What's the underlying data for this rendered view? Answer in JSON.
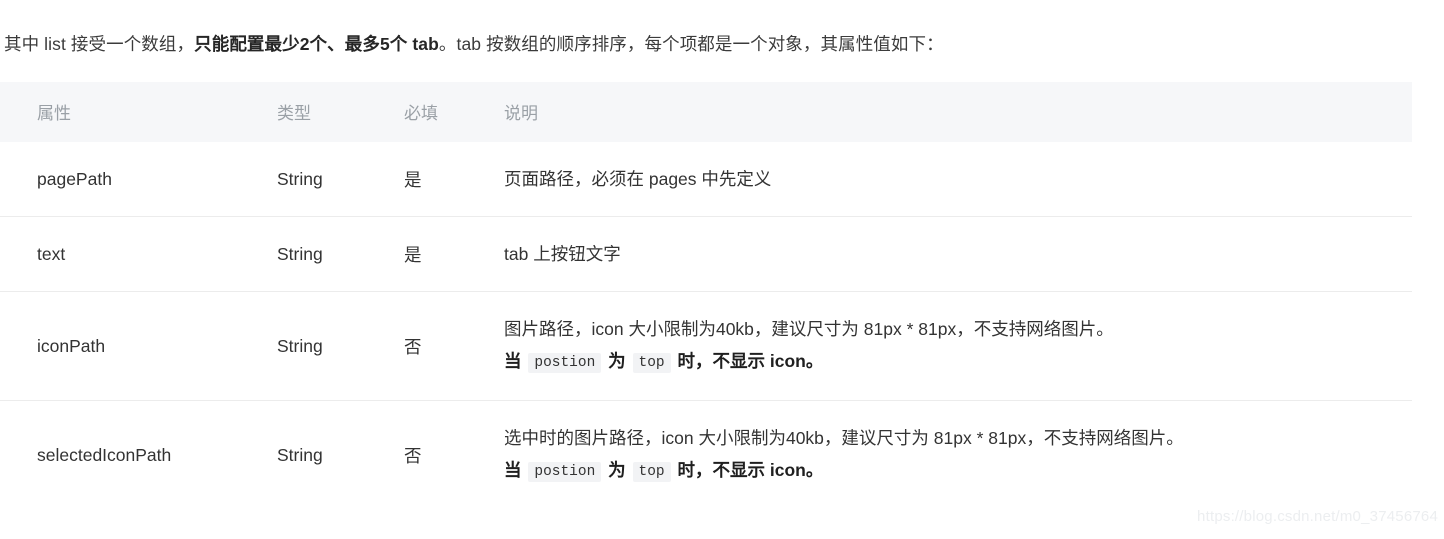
{
  "intro": {
    "segments": [
      {
        "text": "其中 list 接受一个数组，",
        "bold": false
      },
      {
        "text": "只能配置最少2个、最多5个 tab",
        "bold": true
      },
      {
        "text": "。tab 按数组的顺序排序，每个项都是一个对象，其属性值如下：",
        "bold": false
      }
    ],
    "plain": "其中 list 接受一个数组，只能配置最少2个、最多5个 tab。tab 按数组的顺序排序，每个项都是一个对象，其属性值如下："
  },
  "table": {
    "headers": {
      "attribute": "属性",
      "type": "类型",
      "required": "必填",
      "description": "说明"
    },
    "rows": [
      {
        "attribute": "pagePath",
        "type": "String",
        "required": "是",
        "lines": [
          {
            "bold": false,
            "parts": [
              {
                "kind": "text",
                "text": "页面路径，必须在 pages 中先定义"
              }
            ]
          }
        ]
      },
      {
        "attribute": "text",
        "type": "String",
        "required": "是",
        "lines": [
          {
            "bold": false,
            "parts": [
              {
                "kind": "text",
                "text": "tab 上按钮文字"
              }
            ]
          }
        ]
      },
      {
        "attribute": "iconPath",
        "type": "String",
        "required": "否",
        "lines": [
          {
            "bold": false,
            "parts": [
              {
                "kind": "text",
                "text": "图片路径，icon 大小限制为40kb，建议尺寸为 81px * 81px，不支持网络图片。"
              }
            ]
          },
          {
            "bold": true,
            "parts": [
              {
                "kind": "text",
                "text": "当 "
              },
              {
                "kind": "code",
                "text": "postion"
              },
              {
                "kind": "text",
                "text": " 为 "
              },
              {
                "kind": "code",
                "text": "top"
              },
              {
                "kind": "text",
                "text": " 时，不显示 icon。"
              }
            ]
          }
        ]
      },
      {
        "attribute": "selectedIconPath",
        "type": "String",
        "required": "否",
        "lines": [
          {
            "bold": false,
            "parts": [
              {
                "kind": "text",
                "text": "选中时的图片路径，icon 大小限制为40kb，建议尺寸为 81px * 81px，不支持网络图片。"
              }
            ]
          },
          {
            "bold": true,
            "parts": [
              {
                "kind": "text",
                "text": "当 "
              },
              {
                "kind": "code",
                "text": "postion"
              },
              {
                "kind": "text",
                "text": " 为 "
              },
              {
                "kind": "code",
                "text": "top"
              },
              {
                "kind": "text",
                "text": " 时，不显示 icon。"
              }
            ]
          }
        ]
      }
    ]
  },
  "watermark": {
    "text": "https://blog.csdn.net/m0_37456764"
  },
  "colors": {
    "header_bg": "#f6f7f9",
    "header_text": "#9aa0a6",
    "body_text": "#333333",
    "divider": "#ececec",
    "code_bg": "#f2f3f5",
    "watermark": "#eceef0"
  }
}
